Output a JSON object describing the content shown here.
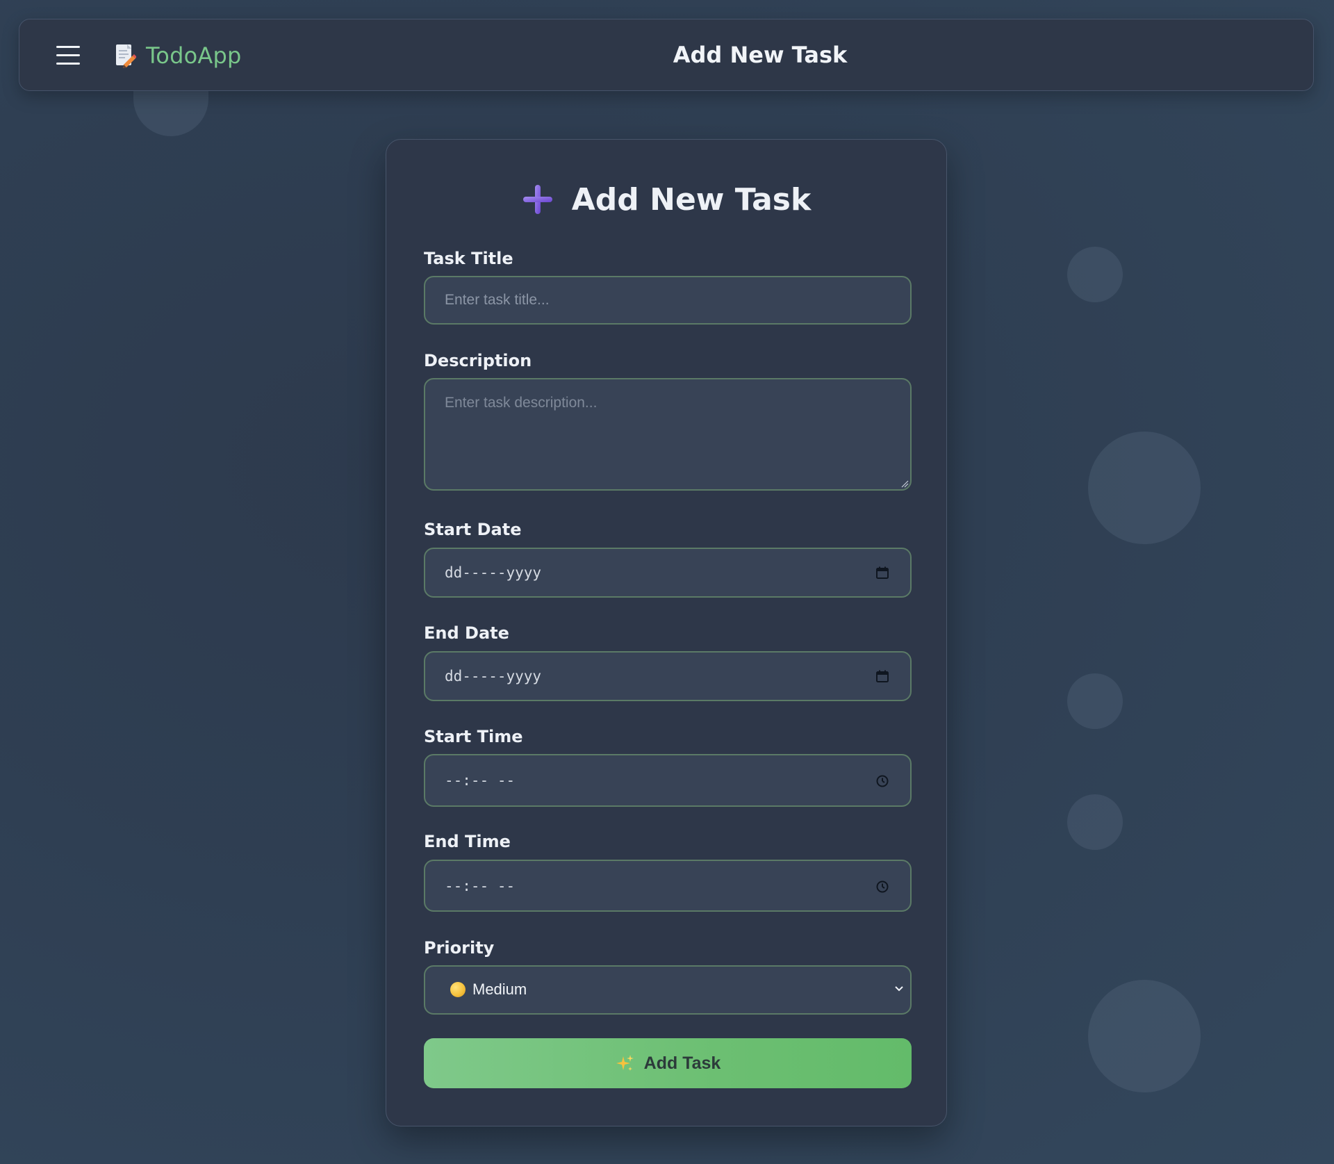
{
  "navbar": {
    "brand_name": "TodoApp",
    "page_title": "Add New Task"
  },
  "form": {
    "heading": "Add New Task",
    "fields": {
      "title": {
        "label": "Task Title",
        "placeholder": "Enter task title..."
      },
      "description": {
        "label": "Description",
        "placeholder": "Enter task description..."
      },
      "start_date": {
        "label": "Start Date",
        "placeholder": "dd-----yyyy"
      },
      "end_date": {
        "label": "End Date",
        "placeholder": "dd-----yyyy"
      },
      "start_time": {
        "label": "Start Time",
        "placeholder": "--:-- --"
      },
      "end_time": {
        "label": "End Time",
        "placeholder": "--:-- --"
      },
      "priority": {
        "label": "Priority",
        "value": "Medium",
        "icon": "yellow-circle-icon"
      }
    },
    "submit_label": "Add Task"
  },
  "colors": {
    "brand_green": "#79c68a",
    "button_green": "#6cbf72",
    "field_border": "#5b7a66",
    "accent_purple": "#7b5cdb"
  }
}
